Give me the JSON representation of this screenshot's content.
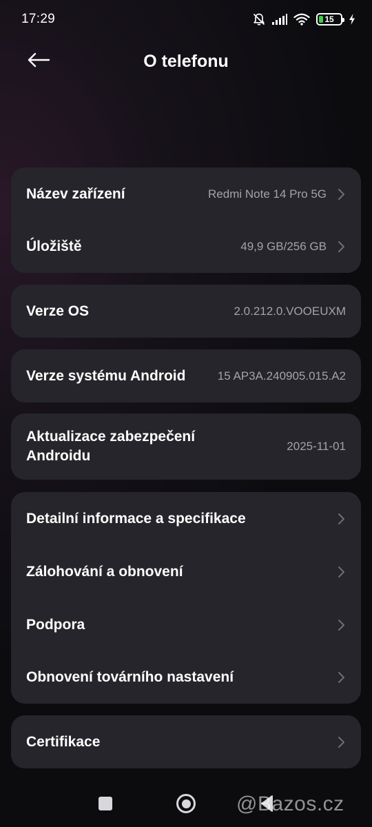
{
  "status_bar": {
    "time": "17:29",
    "battery_level": "15",
    "battery_color": "#3ecf4c",
    "icons": [
      "bell-muted-icon",
      "signal-icon",
      "wifi-icon",
      "battery-icon",
      "charging-icon"
    ]
  },
  "header": {
    "title": "O telefonu",
    "back_icon": "arrow-left-icon"
  },
  "groups": {
    "device": {
      "name_label": "Název zařízení",
      "name_value": "Redmi Note 14 Pro 5G",
      "storage_label": "Úložiště",
      "storage_value": "49,9 GB/256 GB"
    },
    "os": {
      "label": "Verze OS",
      "value": "2.0.212.0.VOOEUXM"
    },
    "android": {
      "label": "Verze systému Android",
      "value": "15 AP3A.240905.015.A2"
    },
    "security": {
      "label_line1": "Aktualizace zabezpečení",
      "label_line2": "Androidu",
      "value": "2025-11-01"
    },
    "more": {
      "details": "Detailní informace a specifikace",
      "backup": "Zálohování a obnovení",
      "support": "Podpora",
      "reset": "Obnovení továrního nastavení"
    },
    "certs": {
      "label": "Certifikace"
    }
  },
  "nav_bar": {
    "icons": [
      "recents-square-icon",
      "home-circle-icon",
      "back-triangle-icon"
    ]
  },
  "watermark": "@Bazos.cz",
  "colors": {
    "card_background": "#26252b",
    "value_text": "#a3a3a8",
    "chevron": "#6e6e74"
  }
}
